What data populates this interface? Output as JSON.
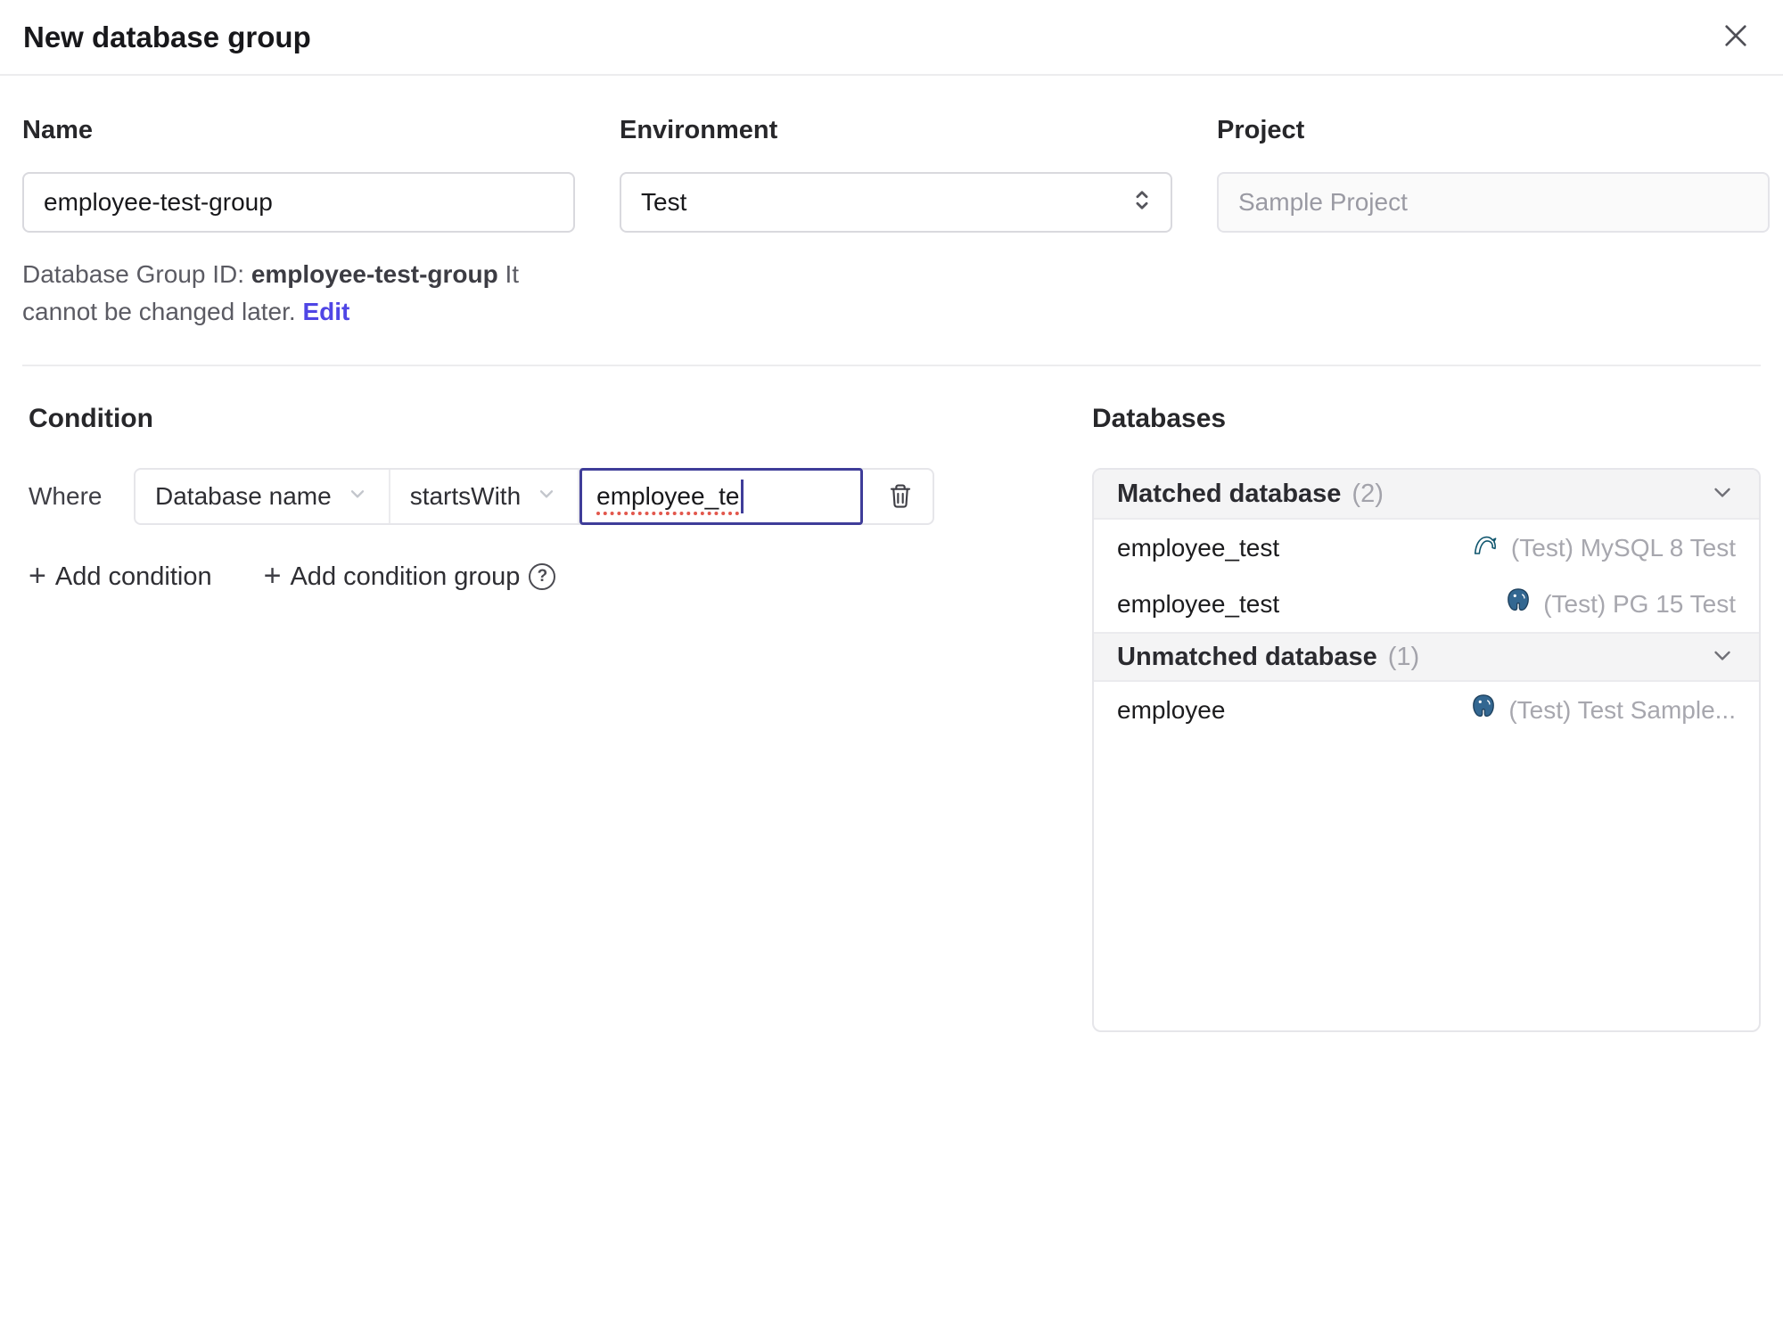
{
  "colors": {
    "accent": "#4f46e5",
    "focus": "#3f3d99",
    "mysql": "#10566e",
    "postgres": "#336791"
  },
  "header": {
    "title": "New database group"
  },
  "form": {
    "name": {
      "label": "Name",
      "value": "employee-test-group"
    },
    "environment": {
      "label": "Environment",
      "value": "Test"
    },
    "project": {
      "label": "Project",
      "value": "Sample Project"
    },
    "group_id_note": {
      "prefix": "Database Group ID: ",
      "id": "employee-test-group",
      "suffix": " It cannot be changed later. ",
      "edit_label": "Edit"
    }
  },
  "condition": {
    "heading": "Condition",
    "where_label": "Where",
    "field": "Database name",
    "operator": "startsWith",
    "value": "employee_te",
    "add_condition": "Add condition",
    "add_condition_group": "Add condition group"
  },
  "databases": {
    "heading": "Databases",
    "sections": [
      {
        "title": "Matched database",
        "count": "(2)",
        "rows": [
          {
            "name": "employee_test",
            "engine": "mysql",
            "instance": "(Test) MySQL 8 Test"
          },
          {
            "name": "employee_test",
            "engine": "postgres",
            "instance": "(Test) PG 15 Test"
          }
        ]
      },
      {
        "title": "Unmatched database",
        "count": "(1)",
        "rows": [
          {
            "name": "employee",
            "engine": "postgres",
            "instance": "(Test) Test Sample..."
          }
        ]
      }
    ]
  }
}
